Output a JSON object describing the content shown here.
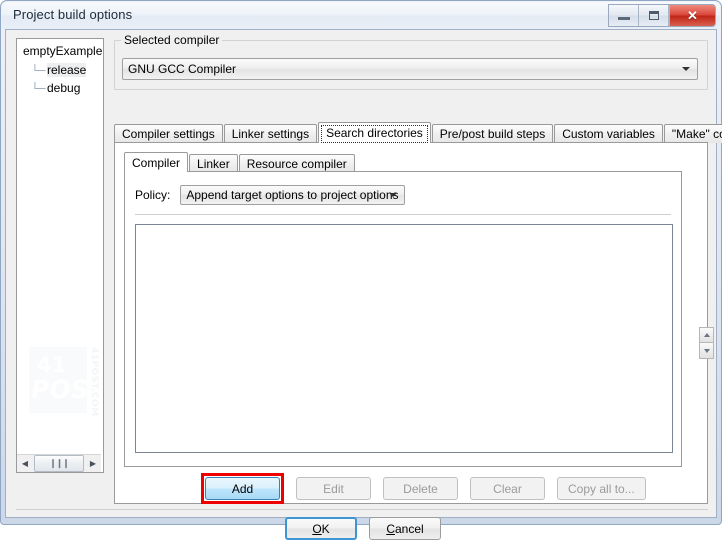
{
  "window": {
    "title": "Project build options",
    "buttons": {
      "minimize": "minimize",
      "restore": "restore",
      "close": "✕"
    }
  },
  "tree": {
    "root": "emptyExample",
    "children": [
      {
        "label": "release",
        "selected": true
      },
      {
        "label": "debug",
        "selected": false
      }
    ],
    "connector": "└─",
    "scrollbar": {
      "left_arrow": "◀",
      "thumb": "❙❙❙",
      "right_arrow": "▶"
    },
    "watermark": {
      "line1": "41",
      "line2": "POST",
      "url": "41POST.COM"
    }
  },
  "compiler_group": {
    "legend": "Selected compiler",
    "selected": "GNU GCC Compiler"
  },
  "tabs": [
    {
      "label": "Compiler settings",
      "active": false
    },
    {
      "label": "Linker settings",
      "active": false
    },
    {
      "label": "Search directories",
      "active": true
    },
    {
      "label": "Pre/post build steps",
      "active": false
    },
    {
      "label": "Custom variables",
      "active": false
    },
    {
      "label": "\"Make\" commands",
      "active": false
    }
  ],
  "subtabs": [
    {
      "label": "Compiler",
      "active": true
    },
    {
      "label": "Linker",
      "active": false
    },
    {
      "label": "Resource compiler",
      "active": false
    }
  ],
  "policy": {
    "label": "Policy:",
    "selected": "Append target options to project options"
  },
  "directory_list": {
    "items": [],
    "move_up": "move-up",
    "move_down": "move-down"
  },
  "actions": [
    {
      "label": "Add",
      "enabled": true,
      "highlighted": true
    },
    {
      "label": "Edit",
      "enabled": false,
      "highlighted": false
    },
    {
      "label": "Delete",
      "enabled": false,
      "highlighted": false
    },
    {
      "label": "Clear",
      "enabled": false,
      "highlighted": false
    },
    {
      "label": "Copy all to...",
      "enabled": false,
      "highlighted": false
    }
  ],
  "footer": {
    "ok": {
      "pre": "",
      "mnemonic": "O",
      "post": "K"
    },
    "cancel": {
      "pre": "",
      "mnemonic": "C",
      "post": "ancel"
    }
  },
  "colors": {
    "highlight_red": "#ee0000",
    "accent_blue": "#3d95d6",
    "close_red": "#bf2417"
  }
}
